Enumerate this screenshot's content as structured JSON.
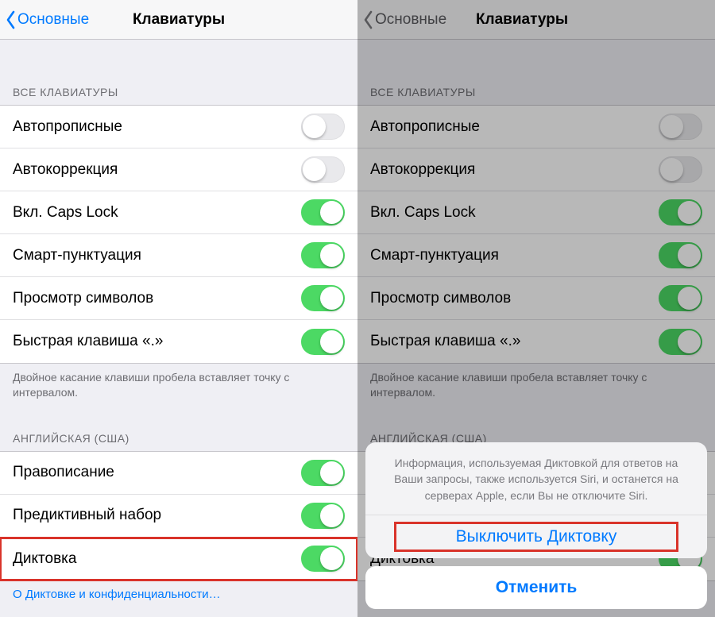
{
  "nav": {
    "back_label": "Основные",
    "title": "Клавиатуры"
  },
  "sections": {
    "all_keyboards_header": "ВСЕ КЛАВИАТУРЫ",
    "all_keyboards": [
      {
        "label": "Автопрописные",
        "on": false
      },
      {
        "label": "Автокоррекция",
        "on": false
      },
      {
        "label": "Вкл. Caps Lock",
        "on": true
      },
      {
        "label": "Смарт-пунктуация",
        "on": true
      },
      {
        "label": "Просмотр символов",
        "on": true
      },
      {
        "label": "Быстрая клавиша «.»",
        "on": true
      }
    ],
    "all_keyboards_footer": "Двойное касание клавиши пробела вставляет точку с интервалом.",
    "english_header": "АНГЛИЙСКАЯ (США)",
    "english": [
      {
        "label": "Правописание",
        "on": true
      },
      {
        "label": "Предиктивный набор",
        "on": true
      },
      {
        "label": "Диктовка",
        "on": true,
        "highlight": true
      }
    ],
    "english_footer_link": "О Диктовке и конфиденциальности…"
  },
  "sheet": {
    "message": "Информация, используемая Диктовкой для ответов на Ваши запросы, также используется Siri, и останется на серверах Apple, если Вы не отключите Siri.",
    "action": "Выключить Диктовку",
    "cancel": "Отменить"
  }
}
